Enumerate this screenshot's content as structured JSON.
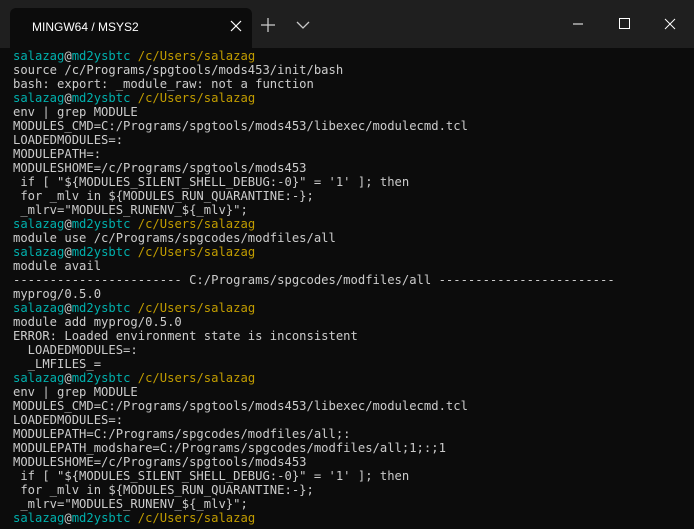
{
  "tab": {
    "title": "MINGW64 / MSYS2"
  },
  "icons": {
    "close": "close-icon",
    "new_tab": "plus-icon",
    "dropdown": "chevron-down-icon",
    "minimize": "minimize-icon",
    "maximize": "maximize-icon",
    "window_close": "close-icon"
  },
  "colors": {
    "background": "#0c0c0c",
    "titlebar": "#1f1f1f",
    "text": "#cccccc",
    "user_host": "#00b0ad",
    "path": "#c19c00"
  },
  "terminal": {
    "lines": [
      {
        "prompt": {
          "user": "salazag",
          "at": "@",
          "host": "md2ysbtc",
          "path": " /c/Users/salazag"
        }
      },
      {
        "text": "source /c/Programs/spgtools/mods453/init/bash"
      },
      {
        "text": "bash: export: _module_raw: not a function"
      },
      {
        "prompt": {
          "user": "salazag",
          "at": "@",
          "host": "md2ysbtc",
          "path": " /c/Users/salazag"
        }
      },
      {
        "text": "env | grep MODULE"
      },
      {
        "text": "MODULES_CMD=C:/Programs/spgtools/mods453/libexec/modulecmd.tcl"
      },
      {
        "text": "LOADEDMODULES=:"
      },
      {
        "text": "MODULEPATH=:"
      },
      {
        "text": "MODULESHOME=/c/Programs/spgtools/mods453"
      },
      {
        "text": " if [ \"${MODULES_SILENT_SHELL_DEBUG:-0}\" = '1' ]; then"
      },
      {
        "text": " for _mlv in ${MODULES_RUN_QUARANTINE:-};"
      },
      {
        "text": " _mlrv=\"MODULES_RUNENV_${_mlv}\";"
      },
      {
        "prompt": {
          "user": "salazag",
          "at": "@",
          "host": "md2ysbtc",
          "path": " /c/Users/salazag"
        }
      },
      {
        "text": "module use /c/Programs/spgcodes/modfiles/all"
      },
      {
        "prompt": {
          "user": "salazag",
          "at": "@",
          "host": "md2ysbtc",
          "path": " /c/Users/salazag"
        }
      },
      {
        "text": "module avail"
      },
      {
        "text": "----------------------- C:/Programs/spgcodes/modfiles/all ------------------------"
      },
      {
        "text": "myprog/0.5.0"
      },
      {
        "prompt": {
          "user": "salazag",
          "at": "@",
          "host": "md2ysbtc",
          "path": " /c/Users/salazag"
        }
      },
      {
        "text": "module add myprog/0.5.0"
      },
      {
        "text": "ERROR: Loaded environment state is inconsistent"
      },
      {
        "text": "  LOADEDMODULES=:"
      },
      {
        "text": "  _LMFILES_="
      },
      {
        "prompt": {
          "user": "salazag",
          "at": "@",
          "host": "md2ysbtc",
          "path": " /c/Users/salazag"
        }
      },
      {
        "text": "env | grep MODULE"
      },
      {
        "text": "MODULES_CMD=C:/Programs/spgtools/mods453/libexec/modulecmd.tcl"
      },
      {
        "text": "LOADEDMODULES=:"
      },
      {
        "text": "MODULEPATH=C:/Programs/spgcodes/modfiles/all;:"
      },
      {
        "text": "MODULEPATH_modshare=C:/Programs/spgcodes/modfiles/all;1;:;1"
      },
      {
        "text": "MODULESHOME=/c/Programs/spgtools/mods453"
      },
      {
        "text": " if [ \"${MODULES_SILENT_SHELL_DEBUG:-0}\" = '1' ]; then"
      },
      {
        "text": " for _mlv in ${MODULES_RUN_QUARANTINE:-};"
      },
      {
        "text": " _mlrv=\"MODULES_RUNENV_${_mlv}\";"
      },
      {
        "prompt": {
          "user": "salazag",
          "at": "@",
          "host": "md2ysbtc",
          "path": " /c/Users/salazag"
        }
      }
    ]
  }
}
